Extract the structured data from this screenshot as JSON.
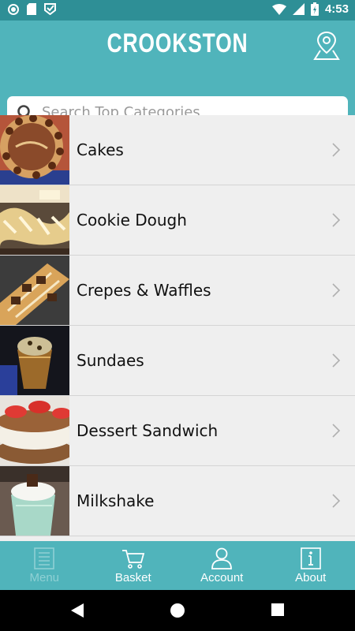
{
  "status_bar": {
    "time": "4:53"
  },
  "header": {
    "title": "CROOKSTON"
  },
  "search": {
    "placeholder": "Search Top Categories",
    "value": ""
  },
  "categories": [
    {
      "label": "Cakes"
    },
    {
      "label": "Cookie Dough"
    },
    {
      "label": "Crepes & Waffles"
    },
    {
      "label": "Sundaes"
    },
    {
      "label": "Dessert Sandwich"
    },
    {
      "label": "Milkshake"
    }
  ],
  "tabs": [
    {
      "label": "Menu",
      "icon": "menu-icon",
      "disabled": true
    },
    {
      "label": "Basket",
      "icon": "basket-icon"
    },
    {
      "label": "Account",
      "icon": "account-icon"
    },
    {
      "label": "About",
      "icon": "about-icon"
    }
  ],
  "colors": {
    "brand": "#50b4bb",
    "status_bar": "#2e8f96",
    "list_background": "#efefef"
  }
}
